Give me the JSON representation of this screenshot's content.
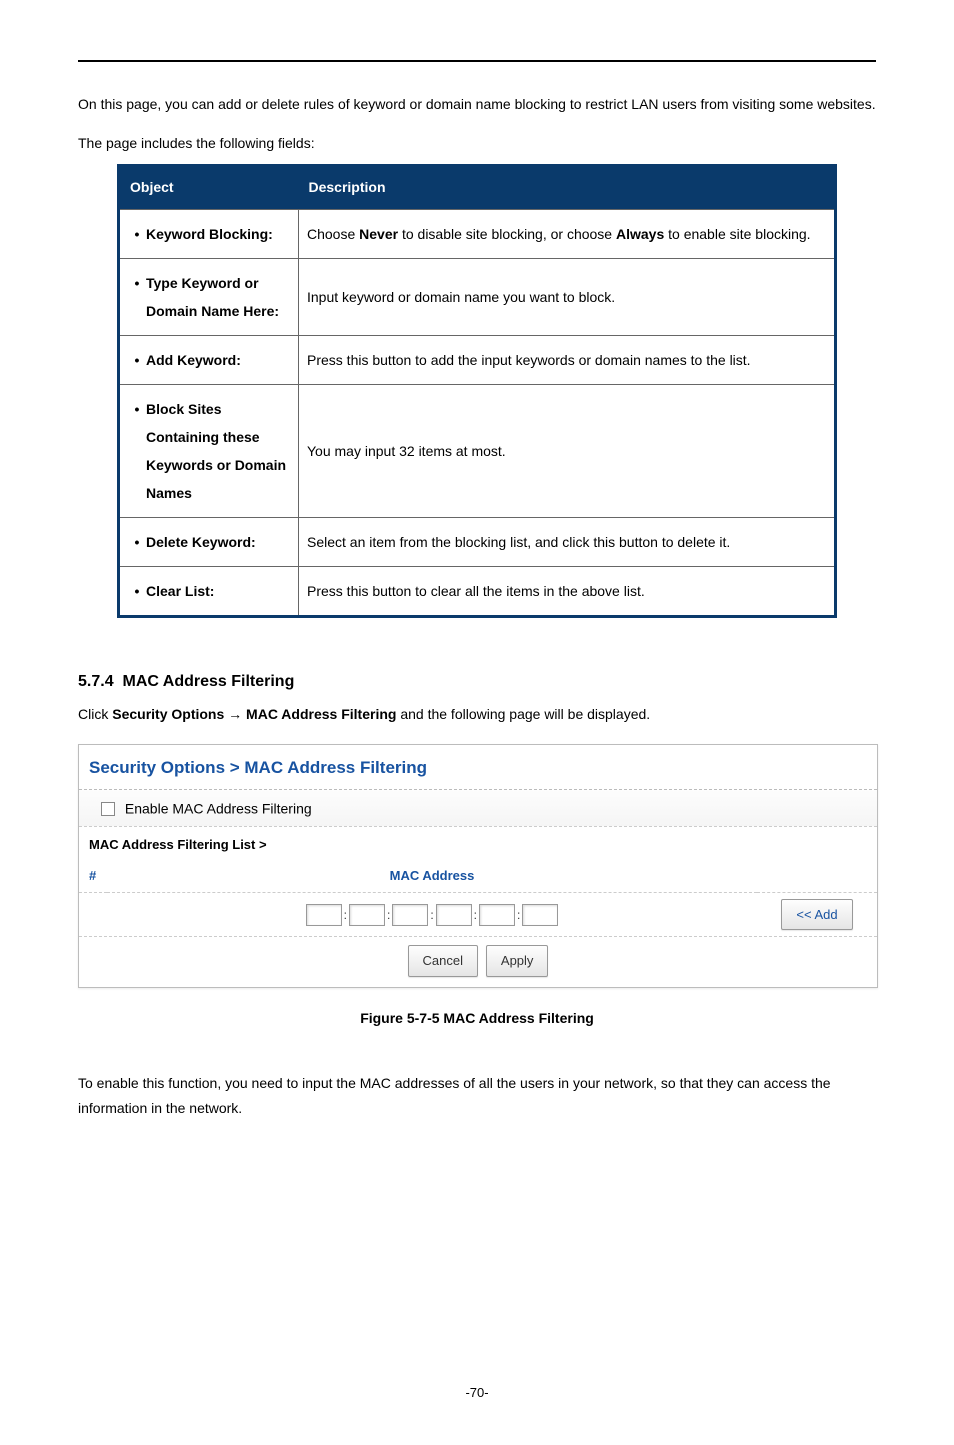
{
  "intro": "On this page, you can add or delete rules of keyword or domain name blocking to restrict LAN users from visiting some websites.",
  "fields_intro": "The page includes the following fields:",
  "table": {
    "head_obj": "Object",
    "head_desc": "Description",
    "rows": [
      {
        "obj": "Keyword Blocking:",
        "desc_pre": "Choose ",
        "desc_b1": "Never",
        "desc_mid": " to disable site blocking, or choose ",
        "desc_b2": "Always",
        "desc_post": " to enable site blocking."
      },
      {
        "obj": "Type Keyword or Domain Name Here:",
        "desc": "Input keyword or domain name you want to block."
      },
      {
        "obj": "Add Keyword:",
        "desc": "Press this button to add the input keywords or domain names to the list."
      },
      {
        "obj": "Block Sites Containing these Keywords or Domain Names",
        "desc": "You may input 32 items at most."
      },
      {
        "obj": "Delete Keyword:",
        "desc": "Select an item from the blocking list, and click this button to delete it."
      },
      {
        "obj": "Clear List:",
        "desc": "Press this button to clear all the items in the above list."
      }
    ]
  },
  "section": {
    "num": "5.7.4",
    "title": "MAC Address Filtering",
    "click_pre": "Click ",
    "click_b1": "Security Options",
    "click_arrow": " → ",
    "click_b2": "MAC Address Filtering",
    "click_post": " and the following page will be displayed."
  },
  "panel": {
    "title": "Security Options > MAC Address Filtering",
    "enable_label": "Enable MAC Address Filtering",
    "list_label": "MAC Address Filtering List >",
    "col_hash": "#",
    "col_mac": "MAC Address",
    "add_btn": "<< Add",
    "cancel": "Cancel",
    "apply": "Apply"
  },
  "figure": "Figure 5-7-5 MAC Address Filtering",
  "enable_para": "To enable this function, you need to input the MAC addresses of all the users in your network, so that they can access the information in the network.",
  "pagenum": "-70-"
}
